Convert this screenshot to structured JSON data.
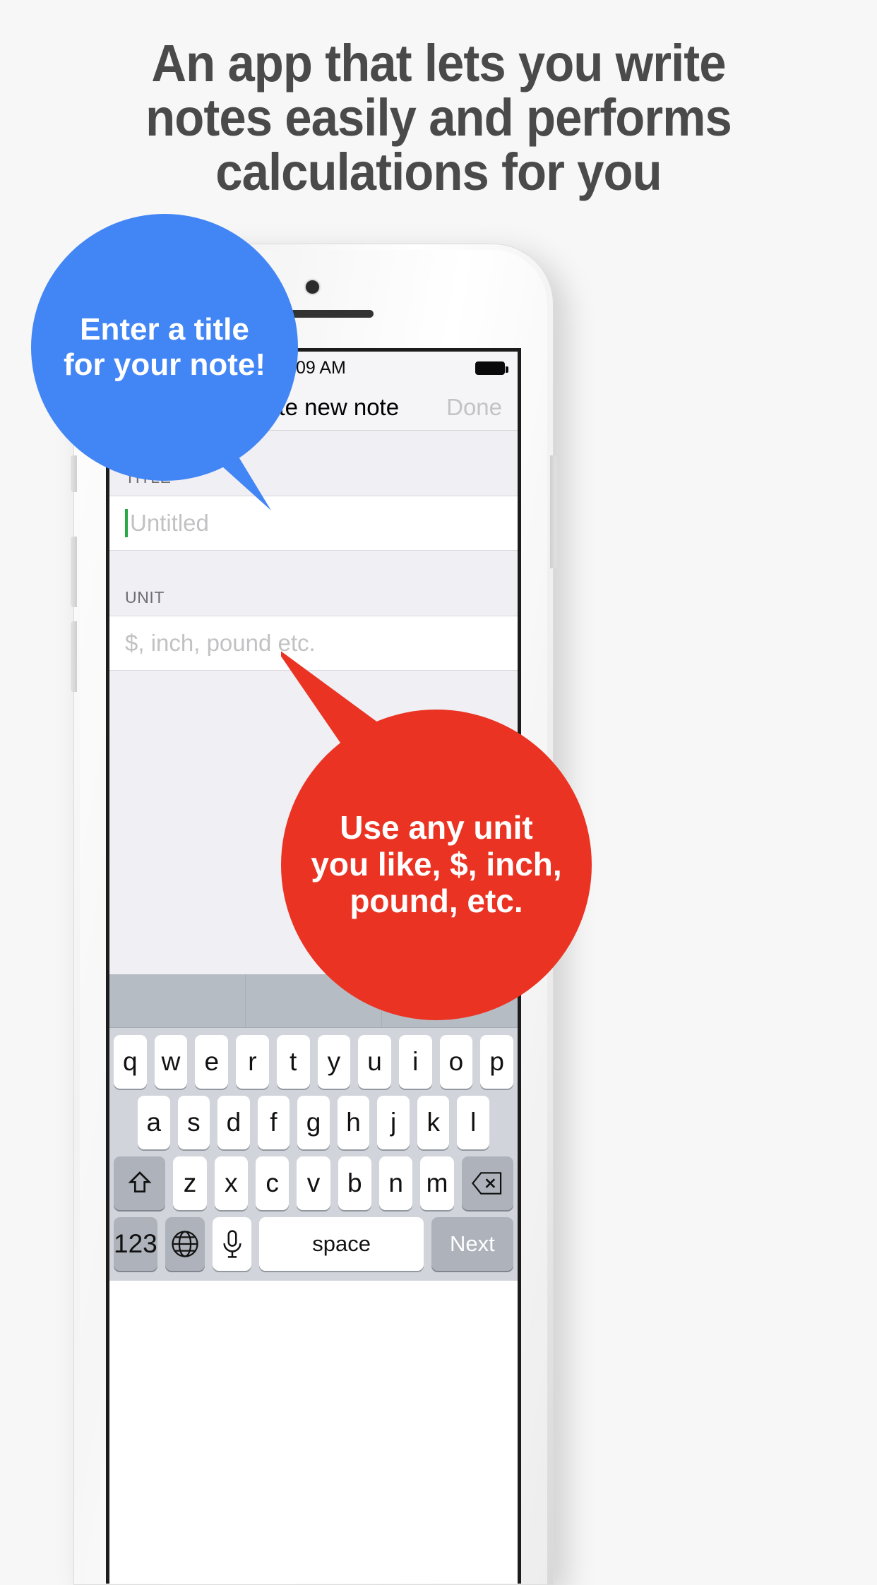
{
  "headline": {
    "lines": [
      "An app that lets you write",
      "notes easily and performs",
      "calculations for you"
    ],
    "color": "#4a4a4a"
  },
  "callouts": [
    {
      "id": "blue",
      "color": "#4285f4",
      "lines": [
        "Enter a title",
        "for your note!"
      ],
      "points_to": "title-field"
    },
    {
      "id": "red",
      "color": "#ea3323",
      "lines": [
        "Use any unit",
        "you like, $, inch,",
        "pound, etc."
      ],
      "points_to": "unit-field"
    }
  ],
  "phone": {
    "statusbar": {
      "time": "1:09 AM"
    },
    "navbar": {
      "title": "Create new note",
      "done_label": "Done"
    },
    "form": {
      "title_section": {
        "header": "TITLE",
        "placeholder": "Untitled",
        "value": ""
      },
      "unit_section": {
        "header": "UNIT",
        "placeholder": "$, inch, pound etc.",
        "value": ""
      }
    },
    "keyboard": {
      "suggestions": [
        "",
        "",
        ""
      ],
      "row1": [
        "q",
        "w",
        "e",
        "r",
        "t",
        "y",
        "u",
        "i",
        "o",
        "p"
      ],
      "row2": [
        "a",
        "s",
        "d",
        "f",
        "g",
        "h",
        "j",
        "k",
        "l"
      ],
      "row3": [
        "z",
        "x",
        "c",
        "v",
        "b",
        "n",
        "m"
      ],
      "shift_key": "shift-icon",
      "backspace_key": "backspace-icon",
      "numeric_key": "123",
      "globe_key": "globe-icon",
      "mic_key": "microphone-icon",
      "space_key": "space",
      "next_key": "Next"
    }
  }
}
